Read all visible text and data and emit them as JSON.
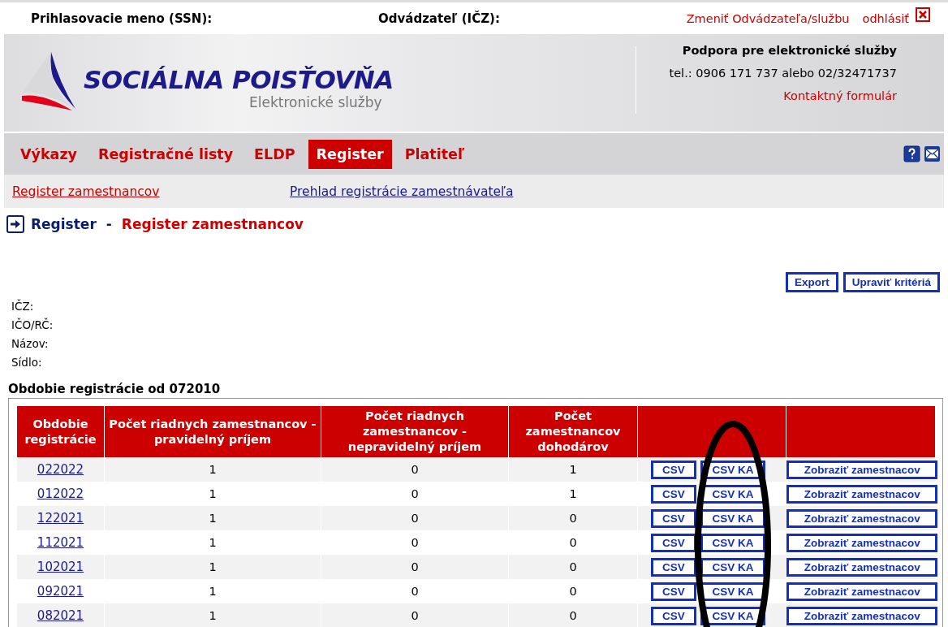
{
  "top_bar": {
    "login_label": "Prihlasovacie meno (SSN):",
    "payer_label": "Odvádzateľ (IČZ):",
    "change_link": "Zmeniť Odvádzateľa/službu",
    "logout_link": "odhlásiť"
  },
  "banner": {
    "logo_title": "SOCIÁLNA POISŤOVŇA",
    "logo_subtitle": "Elektronické služby",
    "support_title": "Podpora pre elektronické služby",
    "support_phone": "tel.: 0906 171 737 alebo 02/32471737",
    "contact_link": "Kontaktný formulár"
  },
  "tabs": [
    {
      "label": "Výkazy",
      "selected": false
    },
    {
      "label": "Registračné listy",
      "selected": false
    },
    {
      "label": "ELDP",
      "selected": false
    },
    {
      "label": "Register",
      "selected": true
    },
    {
      "label": "Platiteľ",
      "selected": false
    }
  ],
  "subtabs": [
    {
      "label": "Register zamestnancov",
      "selected": true
    },
    {
      "label": "Prehlad registrácie zamestnávateľa",
      "selected": false
    }
  ],
  "breadcrumb": {
    "parent": "Register",
    "separator": "-",
    "current": "Register zamestnancov"
  },
  "actions": [
    "Export",
    "Upraviť kritériá"
  ],
  "info_fields": [
    "IČZ:",
    "IČO/RČ:",
    "Názov:",
    "Sídlo:"
  ],
  "table": {
    "title": "Obdobie registrácie od 072010",
    "columns": [
      "Obdobie registrácie",
      "Počet riadnych zamestnancov - pravidelný príjem",
      "Počet riadnych zamestnancov - nepravidelný príjem",
      "Počet zamestnancov dohodárov"
    ],
    "rows": [
      {
        "period": "022022",
        "regular": "1",
        "irregular": "0",
        "contractors": "1",
        "buttons": [
          "CSV",
          "CSV KA",
          "Zobraziť zamestnacov"
        ]
      },
      {
        "period": "012022",
        "regular": "1",
        "irregular": "0",
        "contractors": "1",
        "buttons": [
          "CSV",
          "CSV KA",
          "Zobraziť zamestnacov"
        ]
      },
      {
        "period": "122021",
        "regular": "1",
        "irregular": "0",
        "contractors": "0",
        "buttons": [
          "CSV",
          "CSV KA",
          "Zobraziť zamestnacov"
        ]
      },
      {
        "period": "112021",
        "regular": "1",
        "irregular": "0",
        "contractors": "0",
        "buttons": [
          "CSV",
          "CSV KA",
          "Zobraziť zamestnacov"
        ]
      },
      {
        "period": "102021",
        "regular": "1",
        "irregular": "0",
        "contractors": "0",
        "buttons": [
          "CSV",
          "CSV KA",
          "Zobraziť zamestnacov"
        ]
      },
      {
        "period": "092021",
        "regular": "1",
        "irregular": "0",
        "contractors": "0",
        "buttons": [
          "CSV",
          "CSV KA",
          "Zobraziť zamestnacov"
        ]
      },
      {
        "period": "082021",
        "regular": "1",
        "irregular": "0",
        "contractors": "0",
        "buttons": [
          "CSV",
          "CSV KA",
          "Zobraziť zamestnacov"
        ]
      }
    ]
  }
}
